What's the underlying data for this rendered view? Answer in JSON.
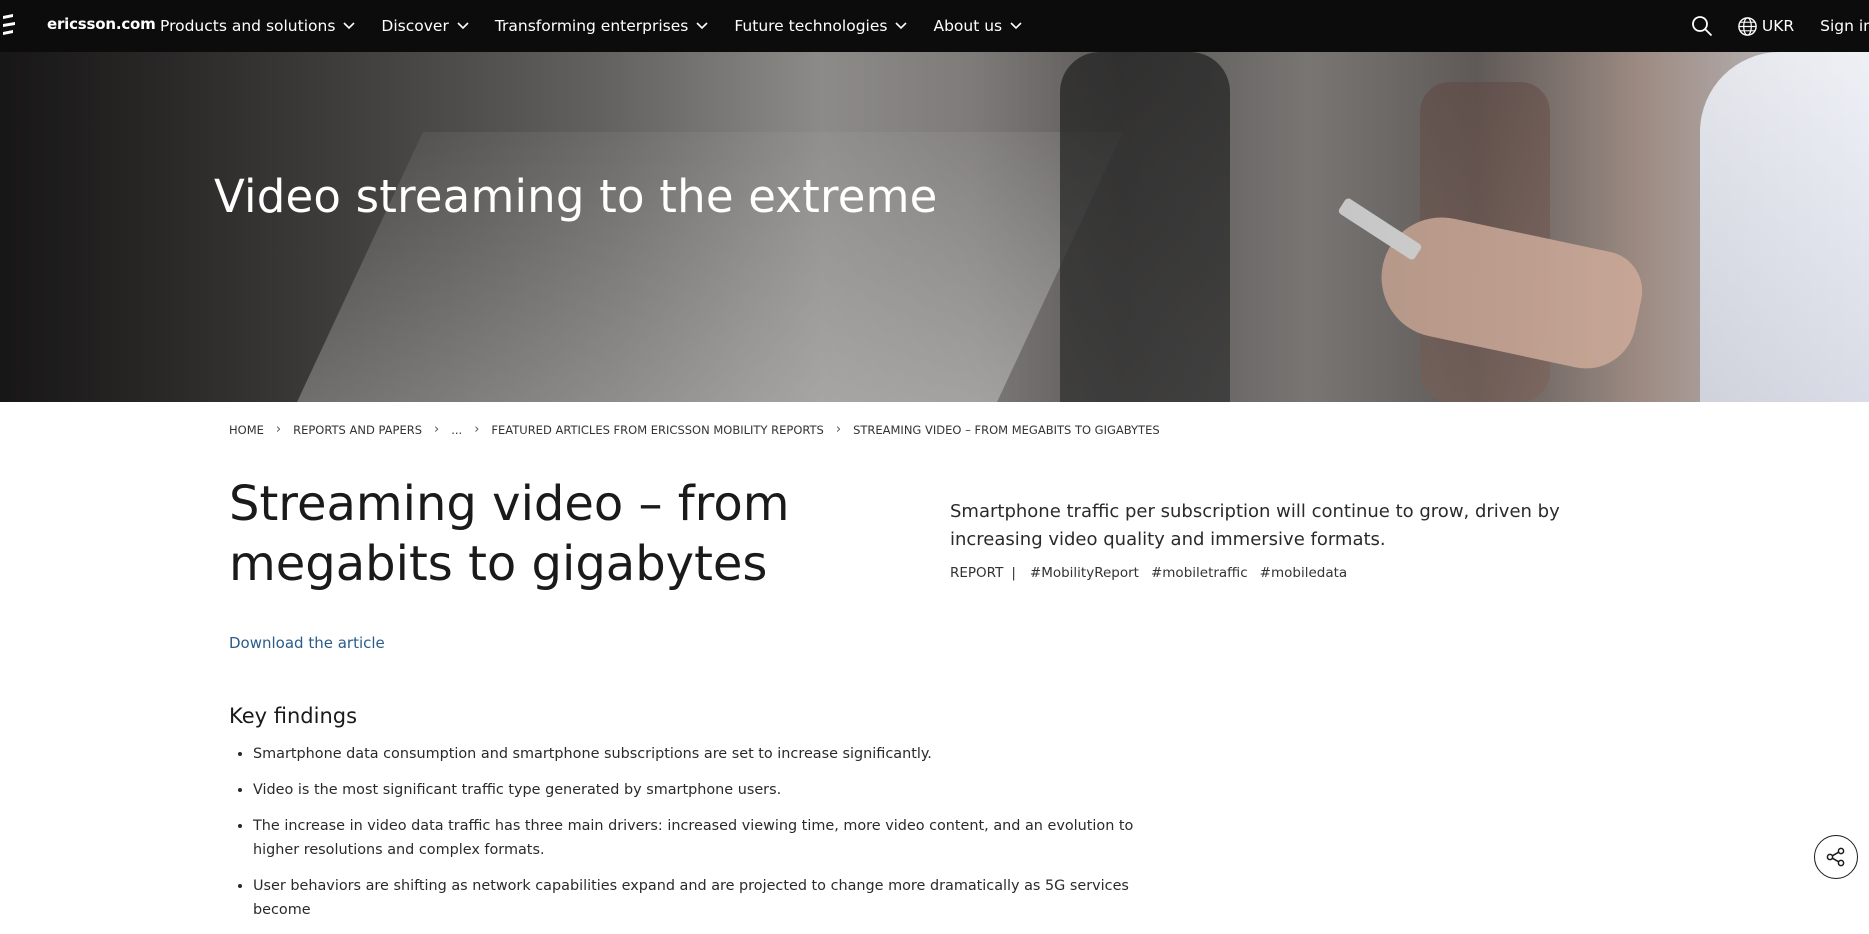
{
  "nav": {
    "brand": "ericsson.com",
    "menu": [
      {
        "label": "Products and solutions"
      },
      {
        "label": "Discover"
      },
      {
        "label": "Transforming enterprises"
      },
      {
        "label": "Future technologies"
      },
      {
        "label": "About us"
      }
    ],
    "lang": "UKR",
    "signin": "Sign in"
  },
  "hero": {
    "title": "Video streaming to the extreme"
  },
  "breadcrumb": [
    "HOME",
    "REPORTS AND PAPERS",
    "...",
    "FEATURED ARTICLES FROM ERICSSON MOBILITY REPORTS",
    "STREAMING VIDEO – FROM MEGABITS TO GIGABYTES"
  ],
  "article": {
    "title": "Streaming video – from megabits to gigabytes",
    "download": "Download the article",
    "intro": "Smartphone traffic per subscription will continue to grow, driven by increasing video quality and immersive formats.",
    "type": "REPORT",
    "pipe": "|",
    "tags": [
      "#MobilityReport",
      "#mobiletraffic",
      "#mobiledata"
    ]
  },
  "key_findings": {
    "heading": "Key findings",
    "items": [
      "Smartphone data consumption and smartphone subscriptions are set to increase significantly.",
      "Video is the most significant traffic type generated by smartphone users.",
      "The increase in video data traffic has three main drivers: increased viewing time, more video content, and an evolution to higher resolutions and complex formats.",
      "User behaviors are shifting as network capabilities expand and are projected to change more dramatically as 5G services become"
    ]
  },
  "icons": {
    "logo": "ericsson-logo-icon",
    "chevron": "chevron-down-icon",
    "search": "search-icon",
    "globe": "globe-icon",
    "share": "share-icon"
  }
}
